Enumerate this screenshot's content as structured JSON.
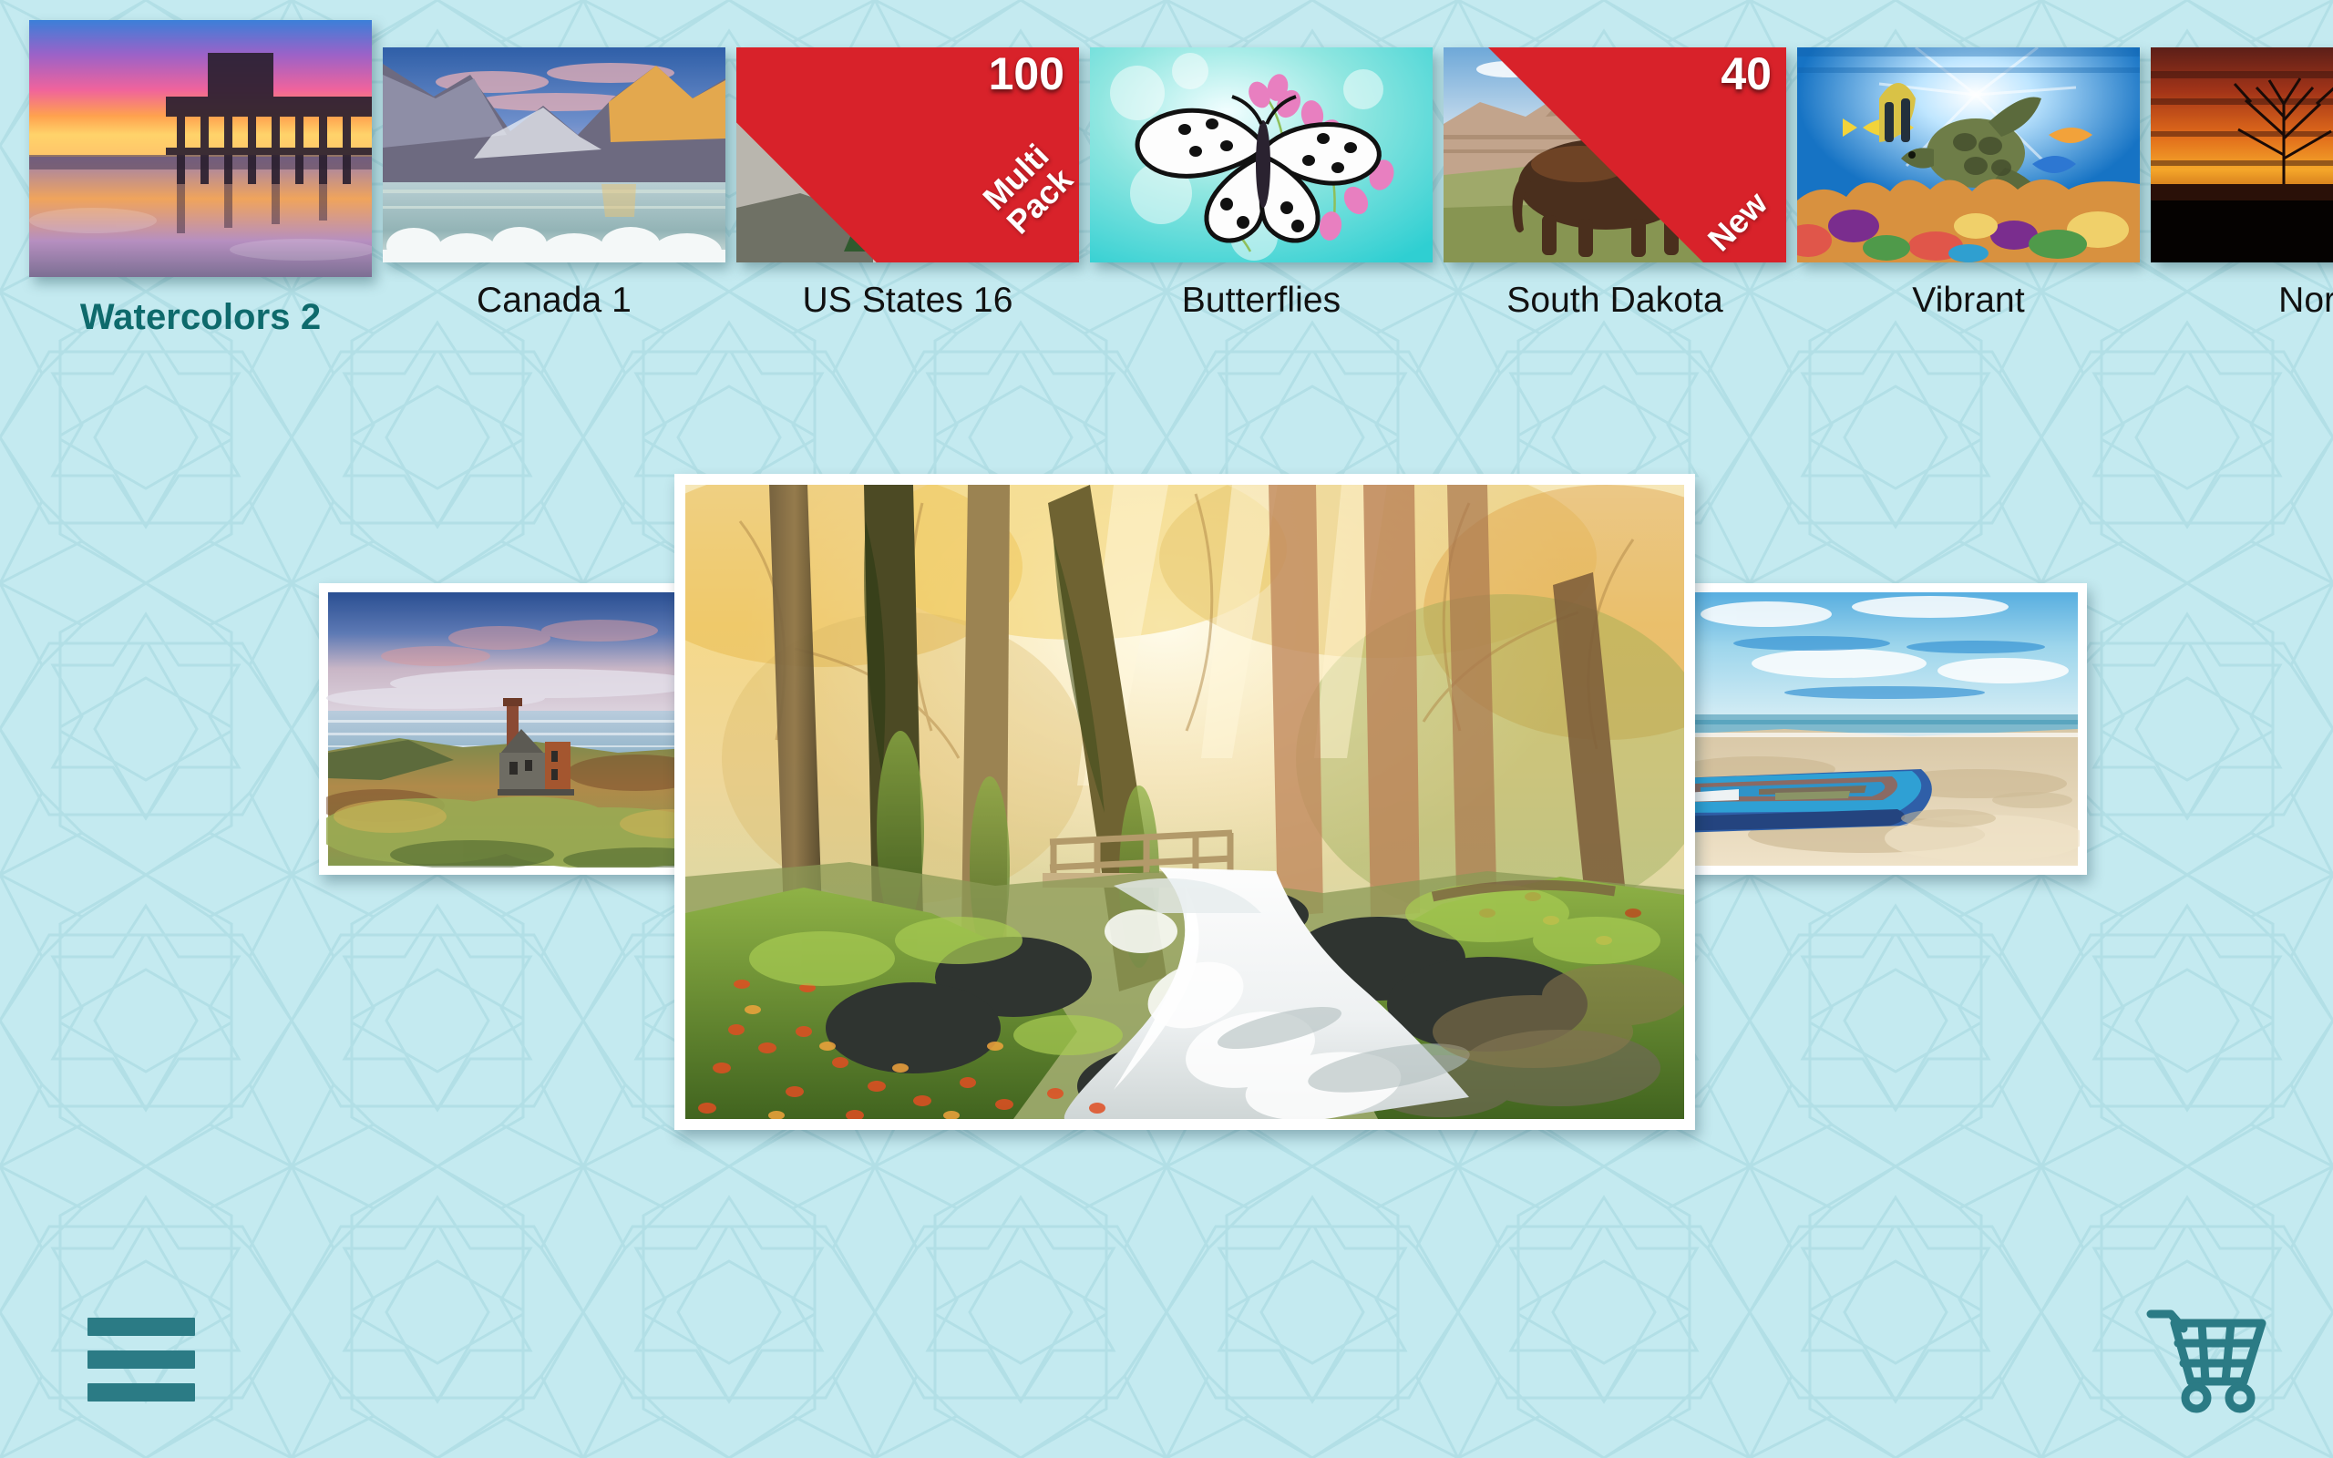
{
  "app": {
    "background_color": "#c4eaf0",
    "accent_color": "#0e6a6c",
    "ribbon_color": "#d8222a"
  },
  "pack_strip": {
    "packs": [
      {
        "label": "Watercolors 2",
        "selected": true,
        "count": "",
        "ribbon": "",
        "thumb_icon": "pier-sunset-thumbnail"
      },
      {
        "label": "Canada 1",
        "selected": false,
        "count": "",
        "ribbon": "",
        "thumb_icon": "lake-louise-thumbnail"
      },
      {
        "label": "US States 16",
        "selected": false,
        "count": "100",
        "ribbon": "Multi\nPack",
        "thumb_icon": "mount-rushmore-thumbnail"
      },
      {
        "label": "Butterflies",
        "selected": false,
        "count": "",
        "ribbon": "",
        "thumb_icon": "butterfly-thumbnail"
      },
      {
        "label": "South Dakota",
        "selected": false,
        "count": "40",
        "ribbon": "New",
        "thumb_icon": "bison-badlands-thumbnail"
      },
      {
        "label": "Vibrant",
        "selected": false,
        "count": "",
        "ribbon": "",
        "thumb_icon": "coral-reef-turtle-thumbnail"
      },
      {
        "label": "North",
        "selected": false,
        "count": "",
        "ribbon": "",
        "thumb_icon": "sunset-tree-silhouette-thumbnail"
      }
    ]
  },
  "carousel": {
    "left_card": {
      "name": "watercolor-cornish-mine-ruin"
    },
    "center_card": {
      "name": "watercolor-autumn-forest-waterfall"
    },
    "right_card": {
      "name": "watercolor-blue-boat-beach"
    }
  },
  "bottom_bar": {
    "menu_icon": "hamburger-menu-icon",
    "cart_icon": "shopping-cart-icon"
  }
}
